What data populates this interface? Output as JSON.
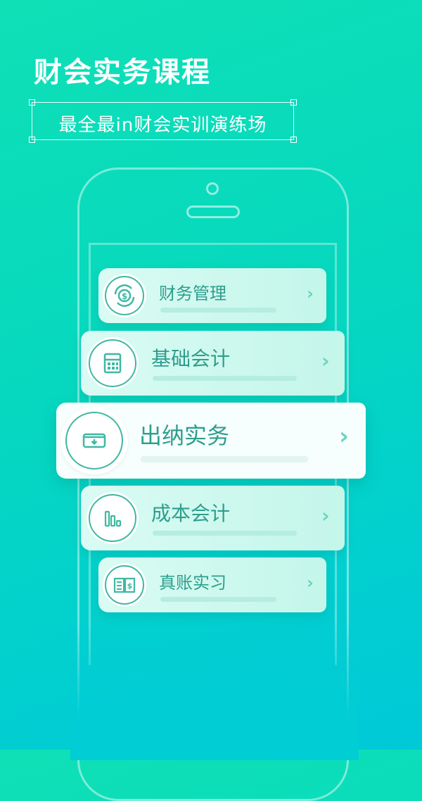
{
  "header": {
    "title": "财会实务课程",
    "subtitle": "最全最in财会实训演练场"
  },
  "courses": [
    {
      "label": "财务管理",
      "icon": "money-cycle-icon"
    },
    {
      "label": "基础会计",
      "icon": "calculator-icon"
    },
    {
      "label": "出纳实务",
      "icon": "cash-drawer-icon"
    },
    {
      "label": "成本会计",
      "icon": "bar-chart-icon"
    },
    {
      "label": "真账实习",
      "icon": "ledger-book-icon"
    }
  ],
  "colors": {
    "accent": "#2d9e8c",
    "background_top": "#0fe0b6",
    "background_bottom": "#00c9d8"
  }
}
